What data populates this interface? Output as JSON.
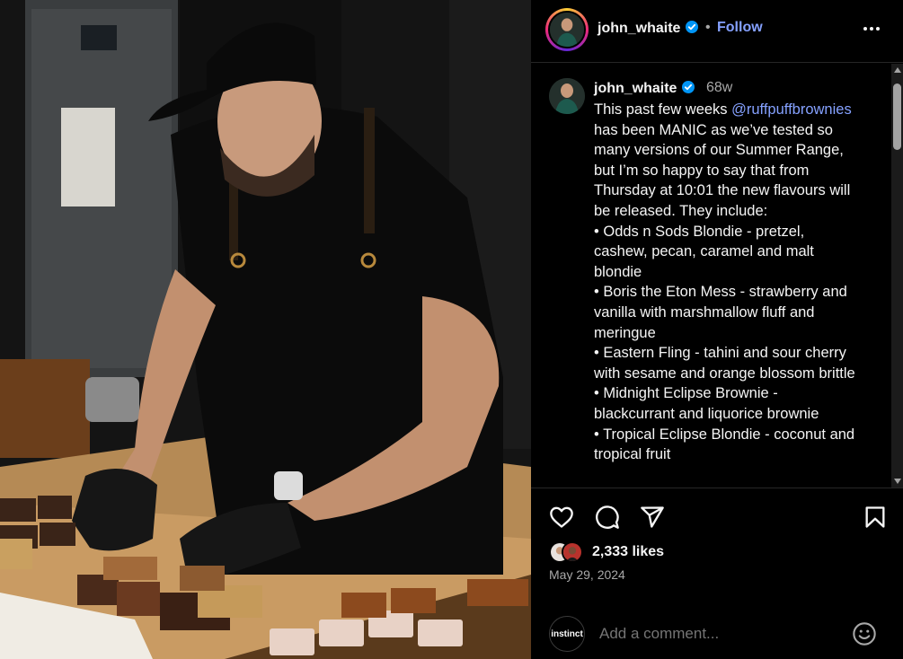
{
  "header": {
    "username": "john_whaite",
    "separator": "•",
    "follow_label": "Follow"
  },
  "post": {
    "username": "john_whaite",
    "age": "68w",
    "caption_before": "This past few weeks ",
    "mention": "@ruffpuffbrownies",
    "caption_after": "\nhas been MANIC as we’ve tested so\nmany versions of our Summer Range,\nbut I’m so happy to say that from\nThursday at 10:01 the new flavours will\nbe released. They include:\n• Odds n Sods Blondie - pretzel,\ncashew, pecan, caramel and malt\nblondie\n• Boris the Eton Mess - strawberry and\nvanilla with marshmallow fluff and\nmeringue\n• Eastern Fling - tahini and sour cherry\nwith sesame and orange blossom brittle\n• Midnight Eclipse Brownie -\nblackcurrant and liquorice brownie\n• Tropical Eclipse Blondie - coconut and\ntropical fruit\n\nWhich will be your fave?"
  },
  "engagement": {
    "likes_label": "2,333 likes",
    "date": "May 29, 2024"
  },
  "comment_box": {
    "avatar_text": "instinct",
    "placeholder": "Add a comment..."
  },
  "icons": {
    "like": "heart-icon",
    "comment": "comment-icon",
    "share": "share-icon",
    "save": "bookmark-icon",
    "more": "more-options-icon",
    "emoji": "emoji-icon",
    "verified": "verified-badge-icon"
  },
  "colors": {
    "accent_link": "#85a1ff",
    "verified": "#0095f6",
    "muted_text": "#a8a8a8"
  }
}
